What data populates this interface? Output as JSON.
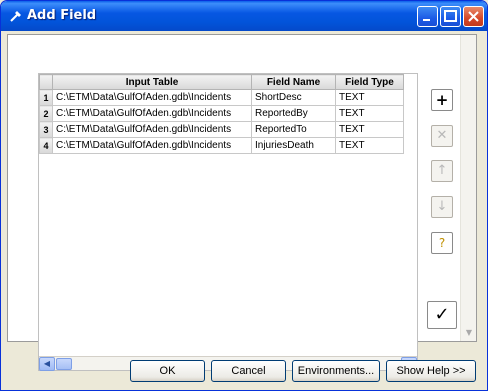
{
  "window": {
    "title": "Add Field"
  },
  "grid": {
    "headers": [
      "Input Table",
      "Field Name",
      "Field Type"
    ],
    "rows": [
      {
        "num": "1",
        "table": "C:\\ETM\\Data\\GulfOfAden.gdb\\Incidents",
        "field": "ShortDesc",
        "type": "TEXT"
      },
      {
        "num": "2",
        "table": "C:\\ETM\\Data\\GulfOfAden.gdb\\Incidents",
        "field": "ReportedBy",
        "type": "TEXT"
      },
      {
        "num": "3",
        "table": "C:\\ETM\\Data\\GulfOfAden.gdb\\Incidents",
        "field": "ReportedTo",
        "type": "TEXT"
      },
      {
        "num": "4",
        "table": "C:\\ETM\\Data\\GulfOfAden.gdb\\Incidents",
        "field": "InjuriesDeath",
        "type": "TEXT"
      }
    ]
  },
  "side_buttons": {
    "add": "+",
    "remove": "✕",
    "up": "↑",
    "down": "↓",
    "help": "?",
    "ok": "✓"
  },
  "buttons": {
    "ok": "OK",
    "cancel": "Cancel",
    "environments": "Environments...",
    "show_help": "Show Help >>"
  },
  "colors": {
    "titlebar": "#0757e3",
    "close": "#d6482a",
    "dialog_bg": "#ece9d8"
  }
}
